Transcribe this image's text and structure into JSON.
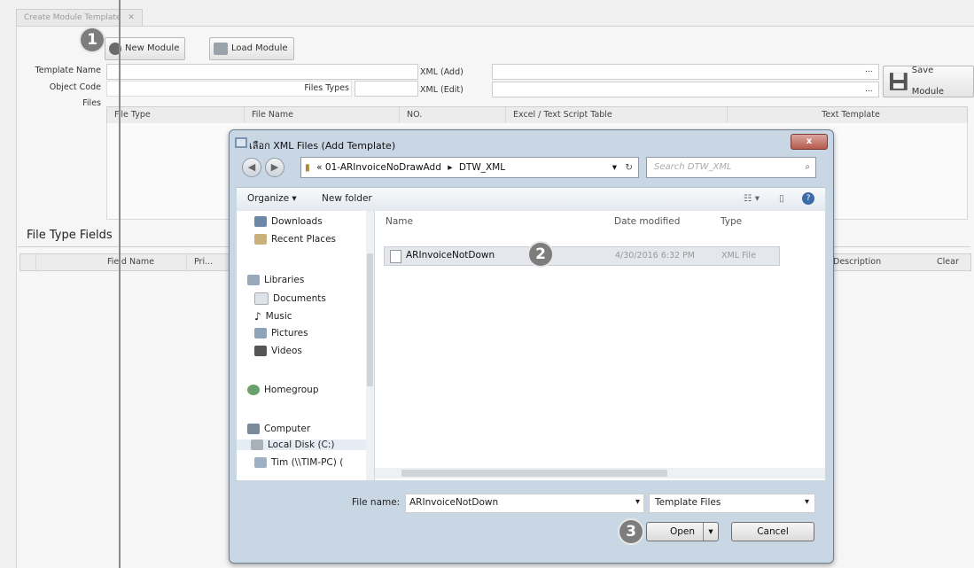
{
  "tab": {
    "title": "Create Module Template",
    "close": "✕"
  },
  "toolbar": {
    "new_module": "New Module",
    "load_module": "Load Module",
    "save_module": "Save Module"
  },
  "form": {
    "template_name_label": "Template Name",
    "object_code_label": "Object Code",
    "files_label": "Files",
    "files_types_label": "Files Types",
    "xml_add_label": "XML (Add)",
    "xml_edit_label": "XML (Edit)",
    "browse": "..."
  },
  "files_grid": {
    "columns": [
      "File Type",
      "File Name",
      "NO.",
      "Excel / Text Script Table",
      "Text Template"
    ]
  },
  "fields_section": {
    "title": "File Type Fields",
    "columns": [
      "Field Name",
      "Pri...",
      "Description",
      "Clear"
    ]
  },
  "badges": [
    "1",
    "2",
    "3"
  ],
  "dialog": {
    "title": "เลือก XML Files (Add Template)",
    "close": "x",
    "address": {
      "prefix": "«",
      "part1": "01-ARInvoiceNoDrawAdd",
      "sep": "▸",
      "part2": "DTW_XML"
    },
    "search_placeholder": "Search DTW_XML",
    "organize": "Organize ▾",
    "new_folder": "New folder",
    "nav": {
      "favorites": [
        "Downloads",
        "Recent Places"
      ],
      "libraries": "Libraries",
      "library_items": [
        "Documents",
        "Music",
        "Pictures",
        "Videos"
      ],
      "homegroup": "Homegroup",
      "computer": "Computer",
      "computer_items": [
        "Local Disk (C:)",
        "Tim (\\\\TIM-PC) ("
      ]
    },
    "columns": {
      "name": "Name",
      "date": "Date modified",
      "type": "Type"
    },
    "file": {
      "name": "ARInvoiceNotDown",
      "date": "4/30/2016 6:32 PM",
      "type": "XML File"
    },
    "file_name_label": "File name:",
    "file_name_value": "ARInvoiceNotDown",
    "filter": "Template Files",
    "open": "Open",
    "cancel": "Cancel"
  }
}
